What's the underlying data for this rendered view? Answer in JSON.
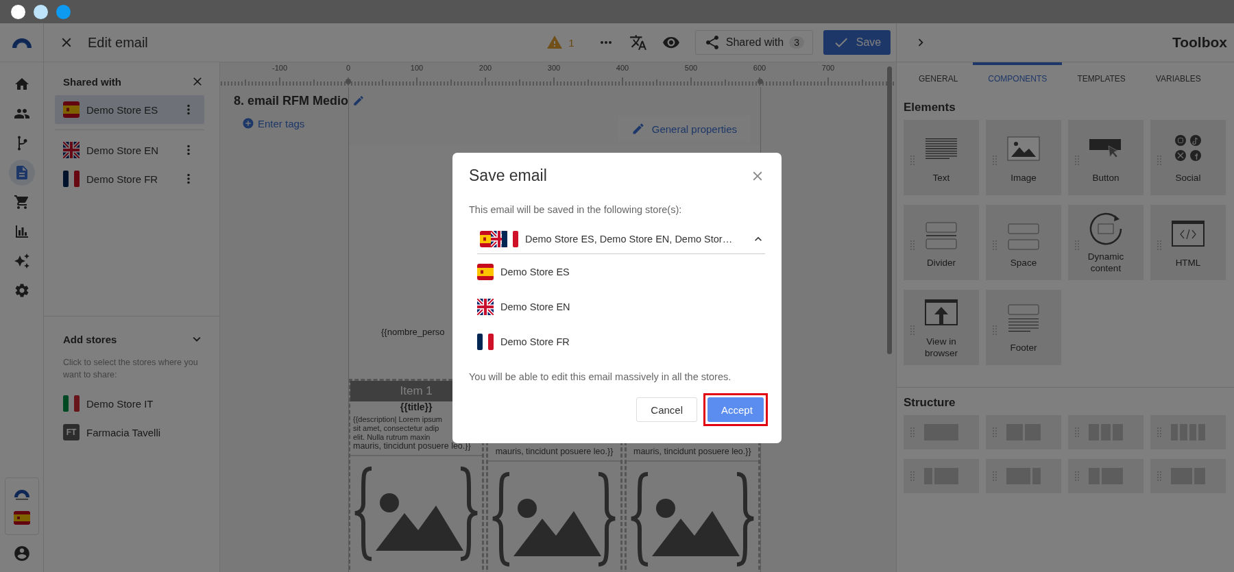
{
  "nav_rail": {
    "items": [
      {
        "selected": false
      },
      {
        "selected": false
      },
      {
        "selected": false
      },
      {
        "selected": true
      },
      {
        "selected": false
      },
      {
        "selected": false
      },
      {
        "selected": false
      },
      {
        "selected": false
      }
    ]
  },
  "header": {
    "title": "Edit email",
    "warnings": "1",
    "shared_button": {
      "label": "Shared with",
      "count": "3"
    },
    "save_button": "Save"
  },
  "shared_panel": {
    "title": "Shared with",
    "stores": [
      {
        "name": "Demo Store ES",
        "kind": "es",
        "selected": true
      },
      {
        "name": "Demo Store EN",
        "kind": "en",
        "selected": false
      },
      {
        "name": "Demo Store FR",
        "kind": "fr",
        "selected": false
      }
    ],
    "add_stores": {
      "title": "Add stores",
      "expanded": true,
      "hint": "Click to select the stores where you want to share:",
      "stores": [
        {
          "name": "Demo Store IT",
          "kind": "it"
        },
        {
          "name": "Farmacia Tavelli",
          "kind": "initials",
          "initials": "FT"
        }
      ]
    }
  },
  "editor": {
    "ruler_labels": [
      "-100",
      "0",
      "100",
      "200",
      "300",
      "400",
      "500",
      "600",
      "700"
    ],
    "email_name": "8. email RFM Medio",
    "tags_link": "Enter tags",
    "properties_button": "General properties",
    "greeting": "{{nombre_perso",
    "products": [
      {
        "header": "Item 1",
        "title": "{{title}}",
        "description_lines": [
          "{{description| Lorem ipsum",
          "sit amet, consectetur adip",
          "elit. Nulla rutrum maxin",
          "mauris, tincidunt posuere leo.}}"
        ]
      },
      {
        "description_lines": [
          "mauris, tincidunt posuere leo.}}"
        ]
      },
      {
        "description_lines": [
          "mauris, tincidunt posuere leo.}}"
        ]
      }
    ]
  },
  "toolbox": {
    "title": "Toolbox",
    "tabs": [
      {
        "label": "GENERAL",
        "selected": false
      },
      {
        "label": "COMPONENTS",
        "selected": true
      },
      {
        "label": "TEMPLATES",
        "selected": false
      },
      {
        "label": "VARIABLES",
        "selected": false
      }
    ],
    "elements_title": "Elements",
    "elements": [
      {
        "label": "Text",
        "kind": "text"
      },
      {
        "label": "Image",
        "kind": "image"
      },
      {
        "label": "Button",
        "kind": "button"
      },
      {
        "label": "Social",
        "kind": "social"
      },
      {
        "label": "Divider",
        "kind": "divider"
      },
      {
        "label": "Space",
        "kind": "space"
      },
      {
        "label": "Dynamic content",
        "kind": "dynamic"
      },
      {
        "label": "HTML",
        "kind": "html"
      },
      {
        "label": "View in browser",
        "kind": "browser"
      },
      {
        "label": "Footer",
        "kind": "footer"
      }
    ],
    "structure_title": "Structure",
    "structures": [
      {
        "kind": "full"
      },
      {
        "kind": "halves"
      },
      {
        "kind": "thirds"
      },
      {
        "kind": "quarters"
      },
      {
        "kind": "quarterleft"
      },
      {
        "kind": "quarterright"
      },
      {
        "kind": "thirdleft"
      },
      {
        "kind": "thirdright"
      }
    ]
  },
  "modal": {
    "title": "Save email",
    "intro": "This email will be saved in the following store(s):",
    "dropdown": {
      "value": "Demo Store ES, Demo Store EN, Demo Stor…",
      "expanded": true,
      "flags": [
        {
          "kind": "es"
        },
        {
          "kind": "en"
        },
        {
          "kind": "fr"
        }
      ]
    },
    "options": [
      {
        "name": "Demo Store ES",
        "kind": "es"
      },
      {
        "name": "Demo Store EN",
        "kind": "en"
      },
      {
        "name": "Demo Store FR",
        "kind": "fr"
      }
    ],
    "note": "You will be able to edit this email massively in all the stores.",
    "buttons": [
      {
        "label": "Cancel",
        "kind": "secondary",
        "highlighted": false
      },
      {
        "label": "Accept",
        "kind": "primary",
        "highlighted": true
      }
    ]
  }
}
